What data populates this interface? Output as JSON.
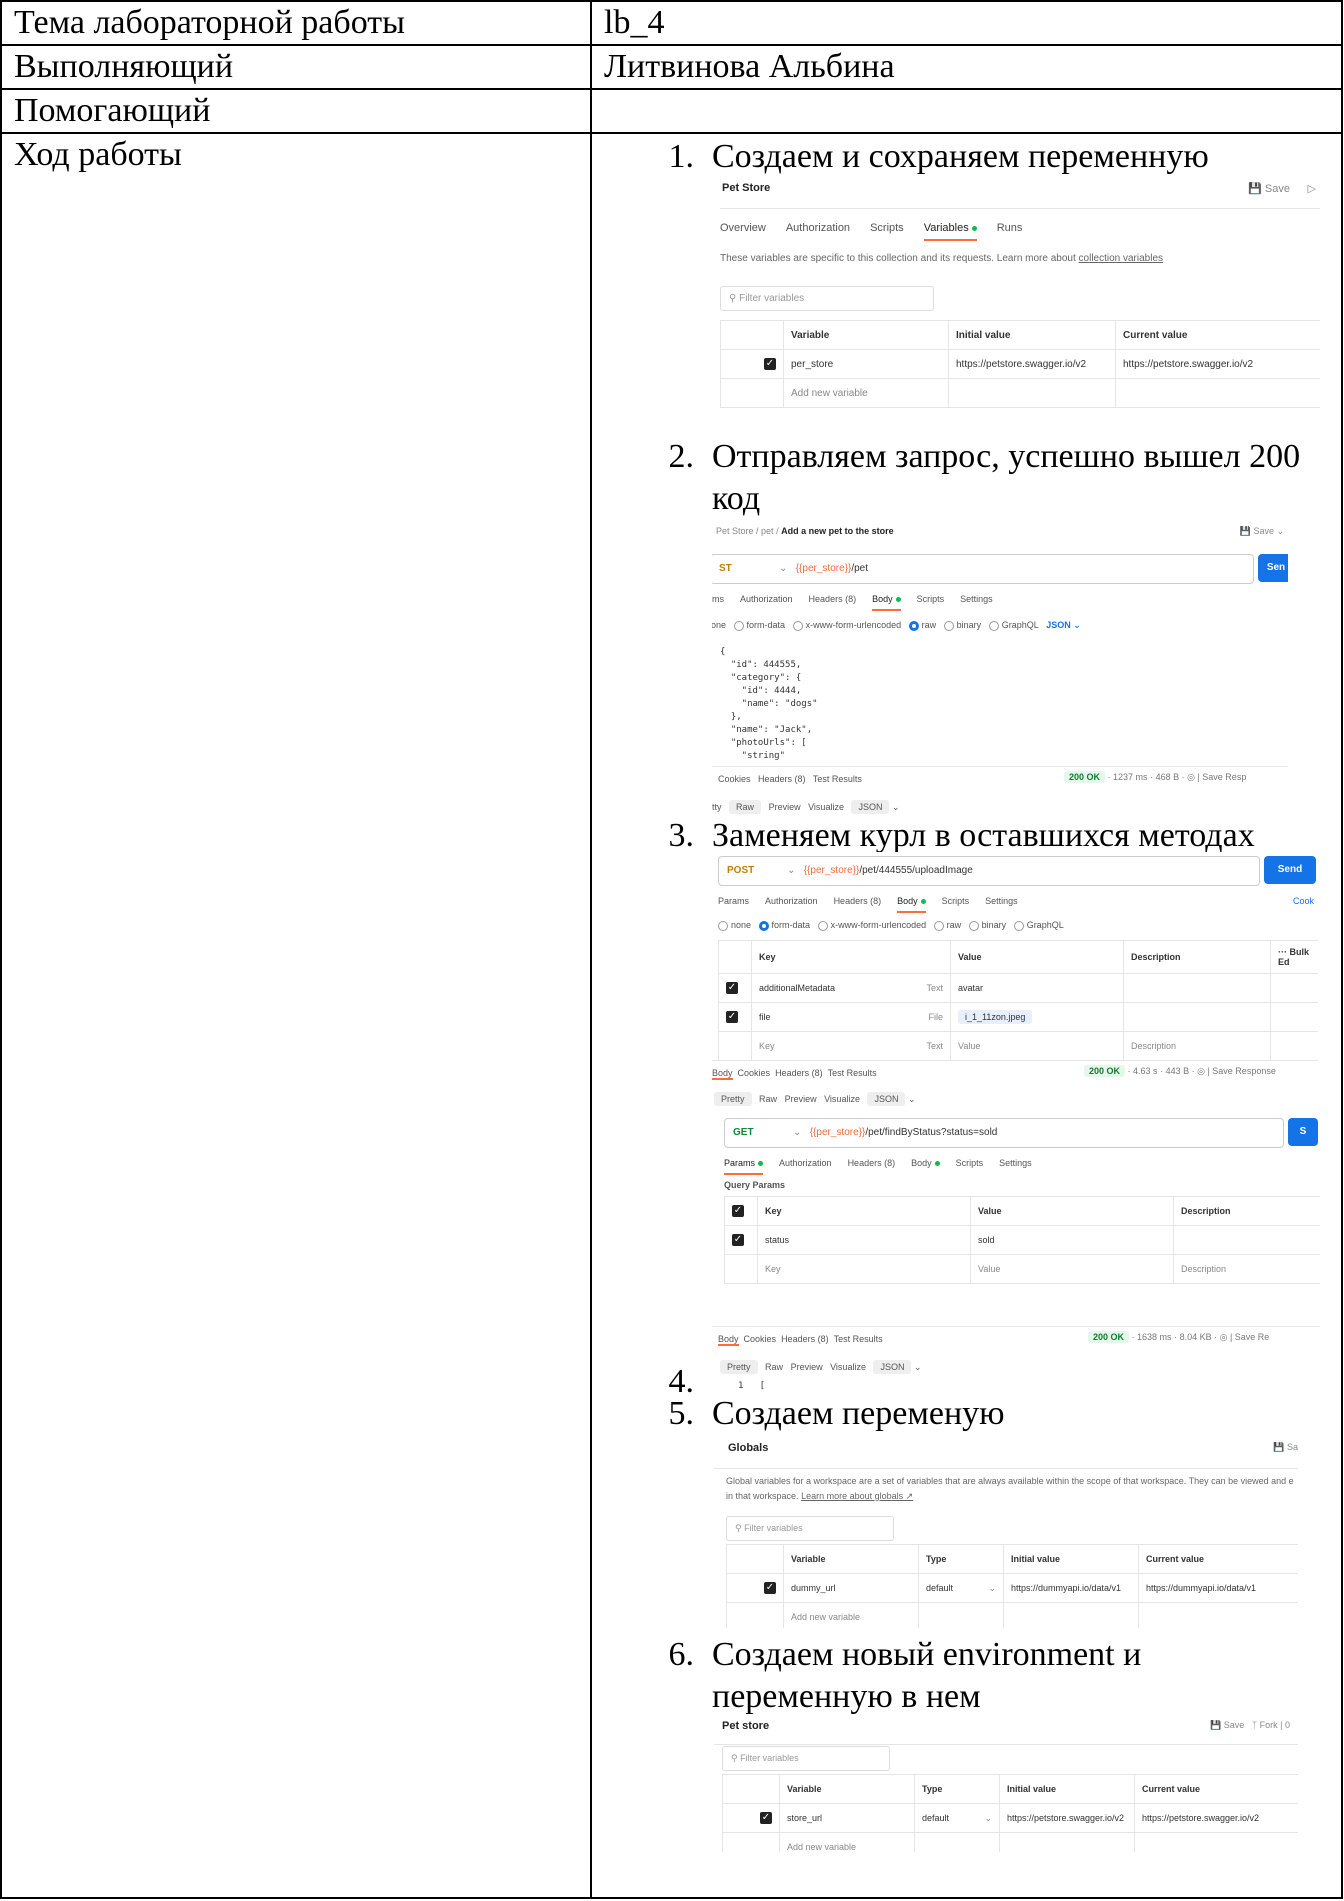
{
  "rows": [
    {
      "label": "Тема лабораторной работы",
      "value": "lb_4"
    },
    {
      "label": "Выполняющий",
      "value": "Литвинова Альбина"
    },
    {
      "label": "Помогающий",
      "value": ""
    },
    {
      "label": "Ход работы"
    }
  ],
  "steps": [
    {
      "num": "1.",
      "text": "Создаем и сохраняем переменную"
    },
    {
      "num": "2.",
      "text": "Отправляем запрос, успешно вышел 200 код"
    },
    {
      "num": "3.",
      "text": "Заменяем курл в оставшихся методах"
    },
    {
      "num": "4.",
      "text": ""
    },
    {
      "num": "5.",
      "text": "Создаем переменую"
    },
    {
      "num": "6.",
      "text": "Создаем новый environment и переменную в нем"
    }
  ],
  "shot1": {
    "title": "Pet Store",
    "save": "Save",
    "tabs": [
      "Overview",
      "Authorization",
      "Scripts",
      "Variables",
      "Runs"
    ],
    "info": "These variables are specific to this collection and its requests. Learn more about",
    "info_link": "collection variables",
    "filter": "Filter variables",
    "cols": [
      "Variable",
      "Initial value",
      "Current value"
    ],
    "var_name": "per_store",
    "initial": "https://petstore.swagger.io/v2",
    "current": "https://petstore.swagger.io/v2",
    "add": "Add new variable"
  },
  "shot2": {
    "crumb_a": "Pet Store",
    "crumb_b": "pet",
    "crumb_c": "Add a new pet to the store",
    "save": "Save",
    "method": "ST",
    "url_var": "{{per_store}}",
    "url_path": "/pet",
    "send": "Sen",
    "tabs": [
      "ms",
      "Authorization",
      "Headers (8)",
      "Body",
      "Scripts",
      "Settings"
    ],
    "body_opts": [
      "none",
      "form-data",
      "x-www-form-urlencoded",
      "raw",
      "binary",
      "GraphQL",
      "JSON"
    ],
    "code": "{\n  \"id\": 444555,\n  \"category\": {\n    \"id\": 4444,\n    \"name\": \"dogs\"\n  },\n  \"name\": \"Jack\",\n  \"photoUrls\": [\n    \"string\"",
    "resp_tabs": [
      "Cookies",
      "Headers (8)",
      "Test Results"
    ],
    "status": "200 OK",
    "time": "1237 ms",
    "size": "468 B",
    "save_resp": "Save Resp",
    "view_tabs": [
      "tty",
      "Raw",
      "Preview",
      "Visualize",
      "JSON"
    ]
  },
  "shot3": {
    "method": "POST",
    "url_var": "{{per_store}}",
    "url_path": "/pet/444555/uploadImage",
    "send": "Send",
    "tabs": [
      "Params",
      "Authorization",
      "Headers (8)",
      "Body",
      "Scripts",
      "Settings"
    ],
    "cookies": "Cook",
    "body_opts": [
      "none",
      "form-data",
      "x-www-form-urlencoded",
      "raw",
      "binary",
      "GraphQL"
    ],
    "cols": [
      "Key",
      "Value",
      "Description",
      "Bulk Ed"
    ],
    "r1_key": "additionalMetadata",
    "r1_type": "Text",
    "r1_val": "avatar",
    "r2_key": "file",
    "r2_type": "File",
    "r2_val": "i_1_11zon.jpeg",
    "r3_key": "Key",
    "r3_type": "Text",
    "r3_val": "Value",
    "r3_desc": "Description",
    "resp_tabs": [
      "Body",
      "Cookies",
      "Headers (8)",
      "Test Results"
    ],
    "status": "200 OK",
    "time": "4.63 s",
    "size": "443 B",
    "save_resp": "Save Response",
    "view_tabs": [
      "Pretty",
      "Raw",
      "Preview",
      "Visualize",
      "JSON"
    ]
  },
  "shot4": {
    "method": "GET",
    "url_var": "{{per_store}}",
    "url_path": "/pet/findByStatus?status=sold",
    "send": "S",
    "tabs": [
      "Params",
      "Authorization",
      "Headers (8)",
      "Body",
      "Scripts",
      "Settings"
    ],
    "query": "Query Params",
    "cols": [
      "Key",
      "Value",
      "Description"
    ],
    "r1_key": "status",
    "r1_val": "sold",
    "r2_key": "Key",
    "r2_val": "Value",
    "r2_desc": "Description",
    "resp_tabs": [
      "Body",
      "Cookies",
      "Headers (8)",
      "Test Results"
    ],
    "status": "200 OK",
    "time": "1638 ms",
    "size": "8.04 KB",
    "save_resp": "Save Re",
    "view_tabs": [
      "Pretty",
      "Raw",
      "Preview",
      "Visualize",
      "JSON"
    ],
    "line": "1   ["
  },
  "shot5": {
    "title": "Globals",
    "save": "Sa",
    "info": "Global variables for a workspace are a set of variables that are always available within the scope of that workspace. They can be viewed and e",
    "info2": "in that workspace.",
    "info_link": "Learn more about globals ↗",
    "filter": "Filter variables",
    "cols": [
      "Variable",
      "Type",
      "Initial value",
      "Current value"
    ],
    "var_name": "dummy_url",
    "type": "default",
    "initial": "https://dummyapi.io/data/v1",
    "current": "https://dummyapi.io/data/v1",
    "add": "Add new variable"
  },
  "shot6": {
    "title": "Pet store",
    "save": "Save",
    "fork": "Fork",
    "fork_count": "0",
    "filter": "Filter variables",
    "cols": [
      "Variable",
      "Type",
      "Initial value",
      "Current value"
    ],
    "var_name": "store_url",
    "type": "default",
    "initial": "https://petstore.swagger.io/v2",
    "current": "https://petstore.swagger.io/v2",
    "add": "Add new variable"
  }
}
